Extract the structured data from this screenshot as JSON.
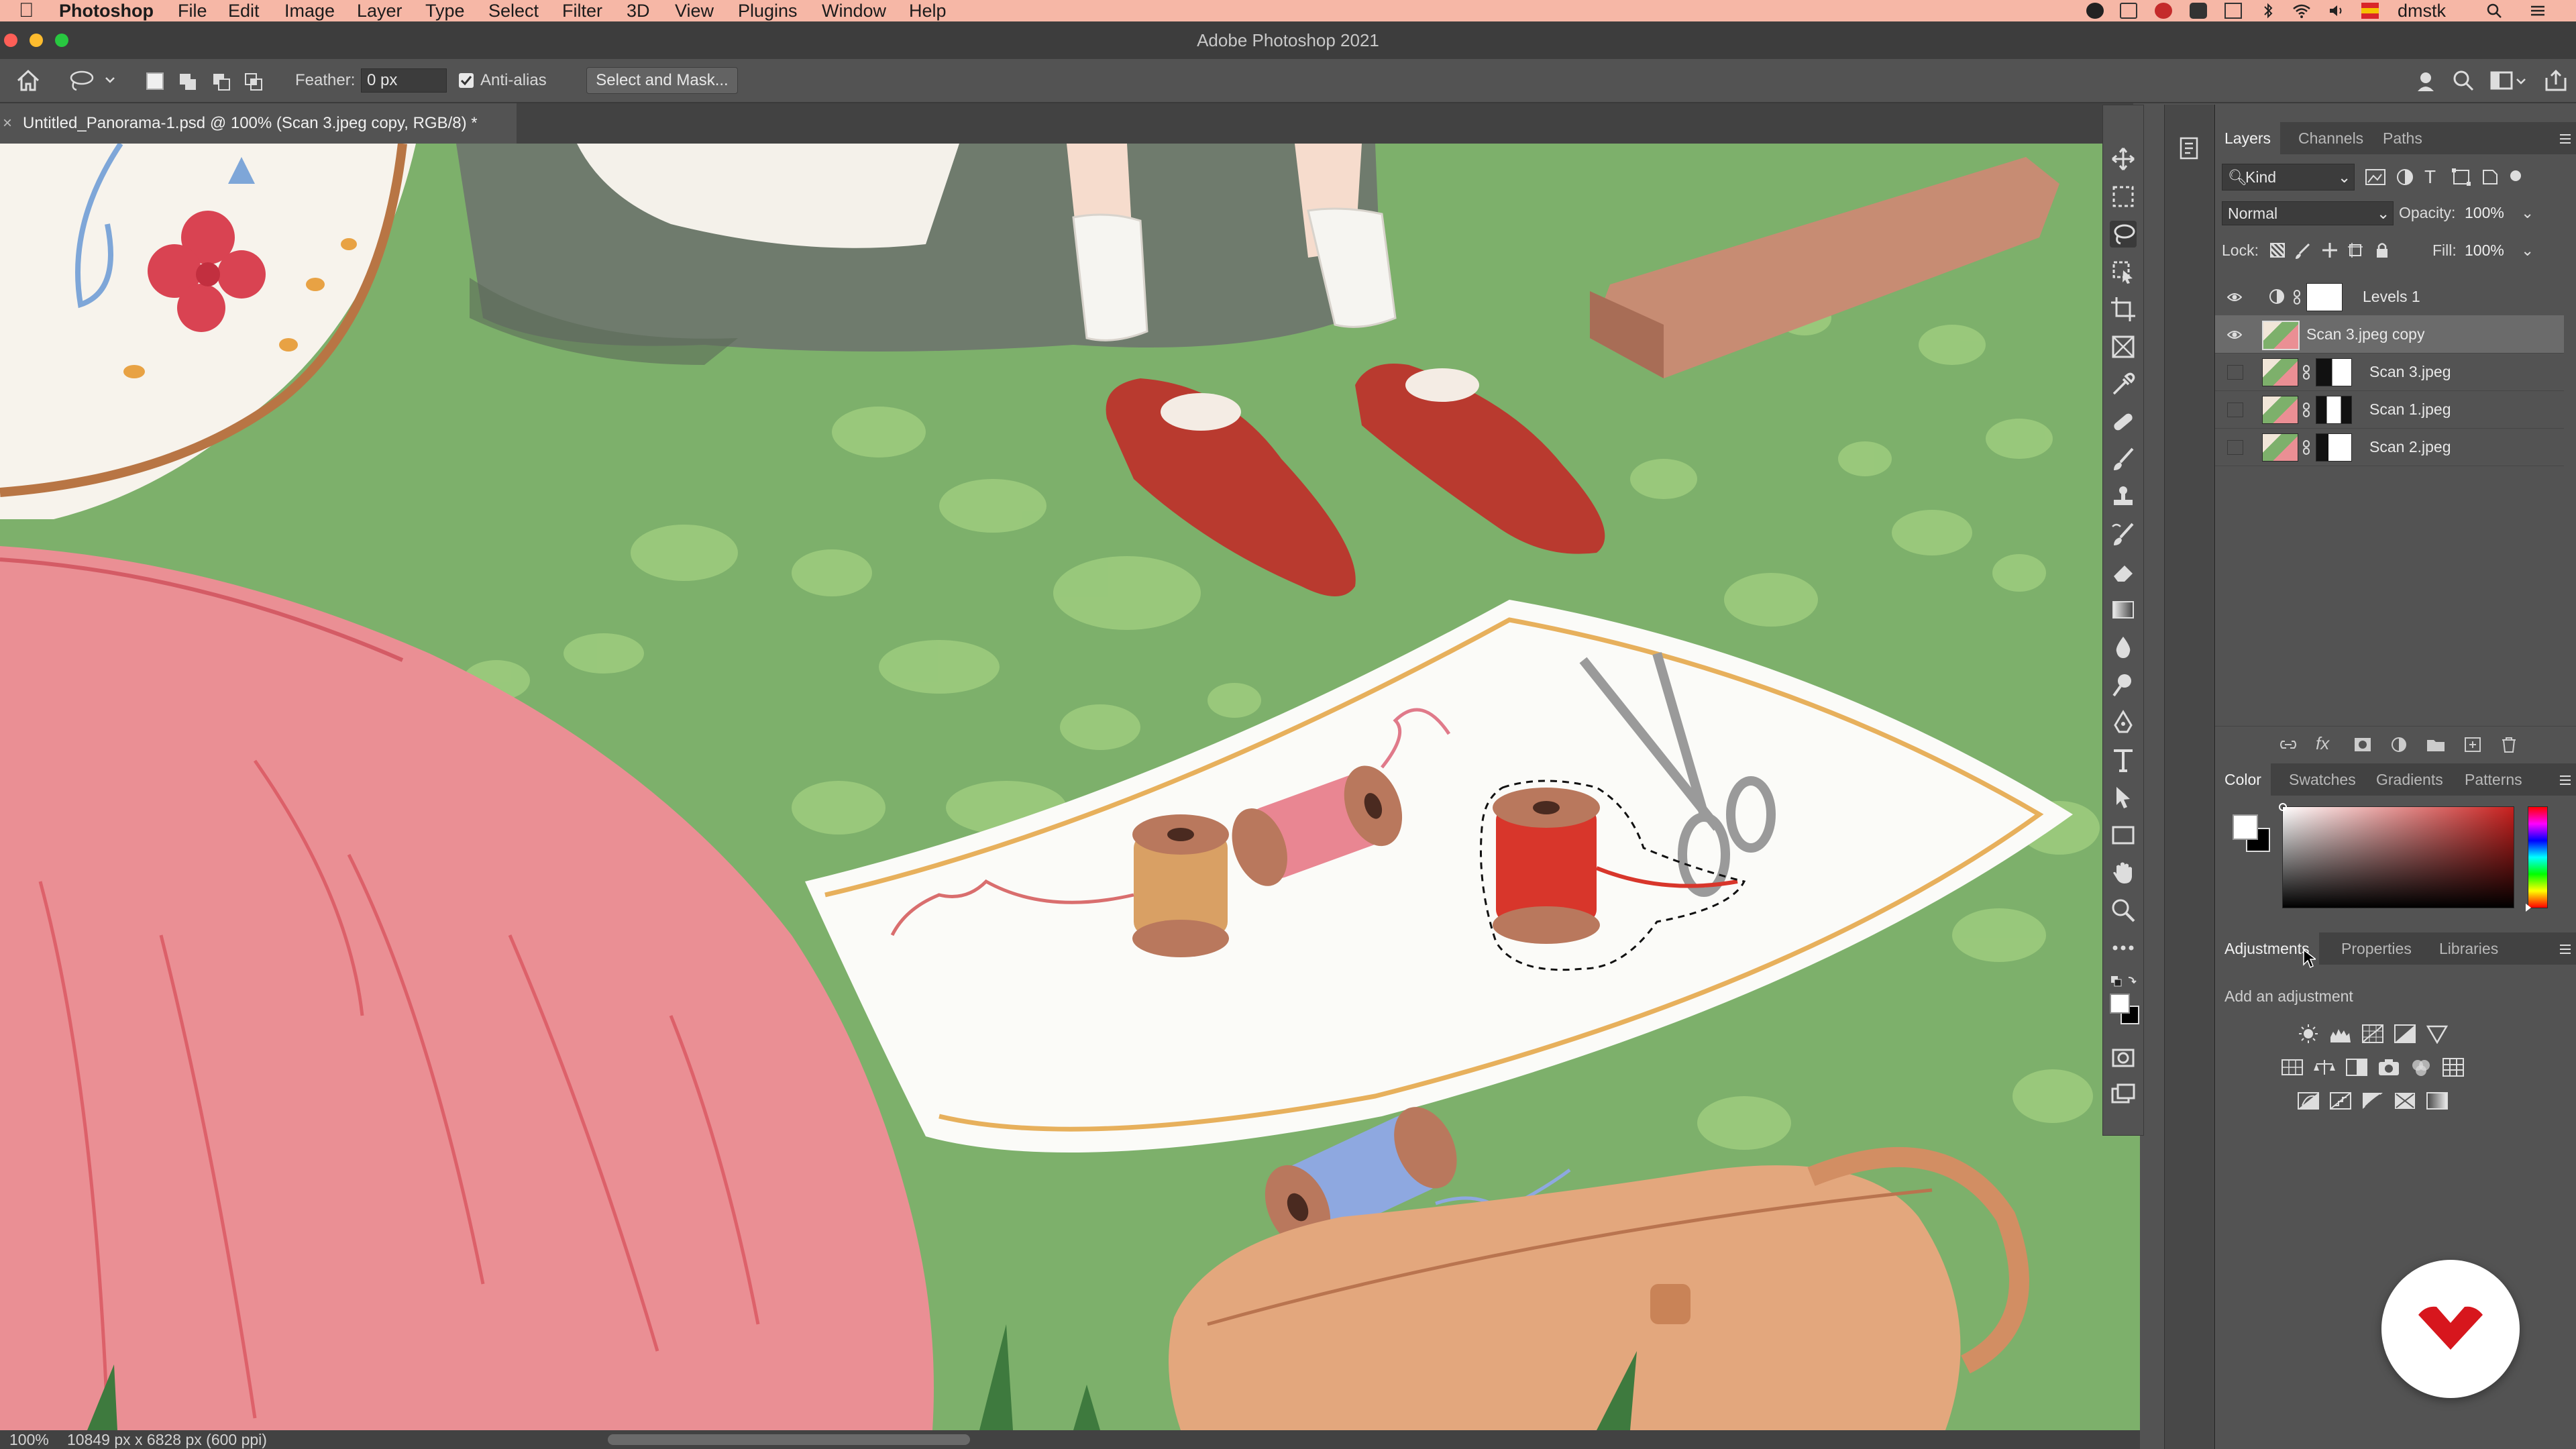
{
  "menubar": {
    "app": "Photoshop",
    "items": [
      "File",
      "Edit",
      "Image",
      "Layer",
      "Type",
      "Select",
      "Filter",
      "3D",
      "View",
      "Plugins",
      "Window",
      "Help"
    ],
    "user": "dmstk"
  },
  "window": {
    "title": "Adobe Photoshop 2021"
  },
  "options": {
    "feather_label": "Feather:",
    "feather_value": "0 px",
    "antialias_label": "Anti-alias",
    "antialias_checked": true,
    "select_mask_label": "Select and Mask..."
  },
  "document": {
    "tab_title": "Untitled_Panorama-1.psd @ 100% (Scan 3.jpeg copy, RGB/8) *",
    "zoom": "100%",
    "status_info": "10849 px x 6828 px (600 ppi)"
  },
  "layers_panel": {
    "tabs": [
      "Layers",
      "Channels",
      "Paths"
    ],
    "active_tab": "Layers",
    "filter_label": "Kind",
    "blend_mode": "Normal",
    "opacity_label": "Opacity:",
    "opacity_value": "100%",
    "lock_label": "Lock:",
    "fill_label": "Fill:",
    "fill_value": "100%",
    "layers": [
      {
        "name": "Levels 1",
        "visible": true,
        "selected": false
      },
      {
        "name": "Scan 3.jpeg copy",
        "visible": true,
        "selected": true
      },
      {
        "name": "Scan 3.jpeg",
        "visible": false,
        "selected": false
      },
      {
        "name": "Scan 1.jpeg",
        "visible": false,
        "selected": false
      },
      {
        "name": "Scan 2.jpeg",
        "visible": false,
        "selected": false
      }
    ]
  },
  "color_panel": {
    "tabs": [
      "Color",
      "Swatches",
      "Gradients",
      "Patterns"
    ],
    "active_tab": "Color",
    "hue_color": "#c8201e"
  },
  "adjustments_panel": {
    "tabs": [
      "Adjustments",
      "Properties",
      "Libraries"
    ],
    "active_tab": "Adjustments",
    "hint": "Add an adjustment"
  },
  "colors": {
    "menubar_bg": "#f6b7a6",
    "panel_bg": "#535353",
    "selected_layer_bg": "#6b6b6b",
    "brand_logo": "#d7161d"
  }
}
